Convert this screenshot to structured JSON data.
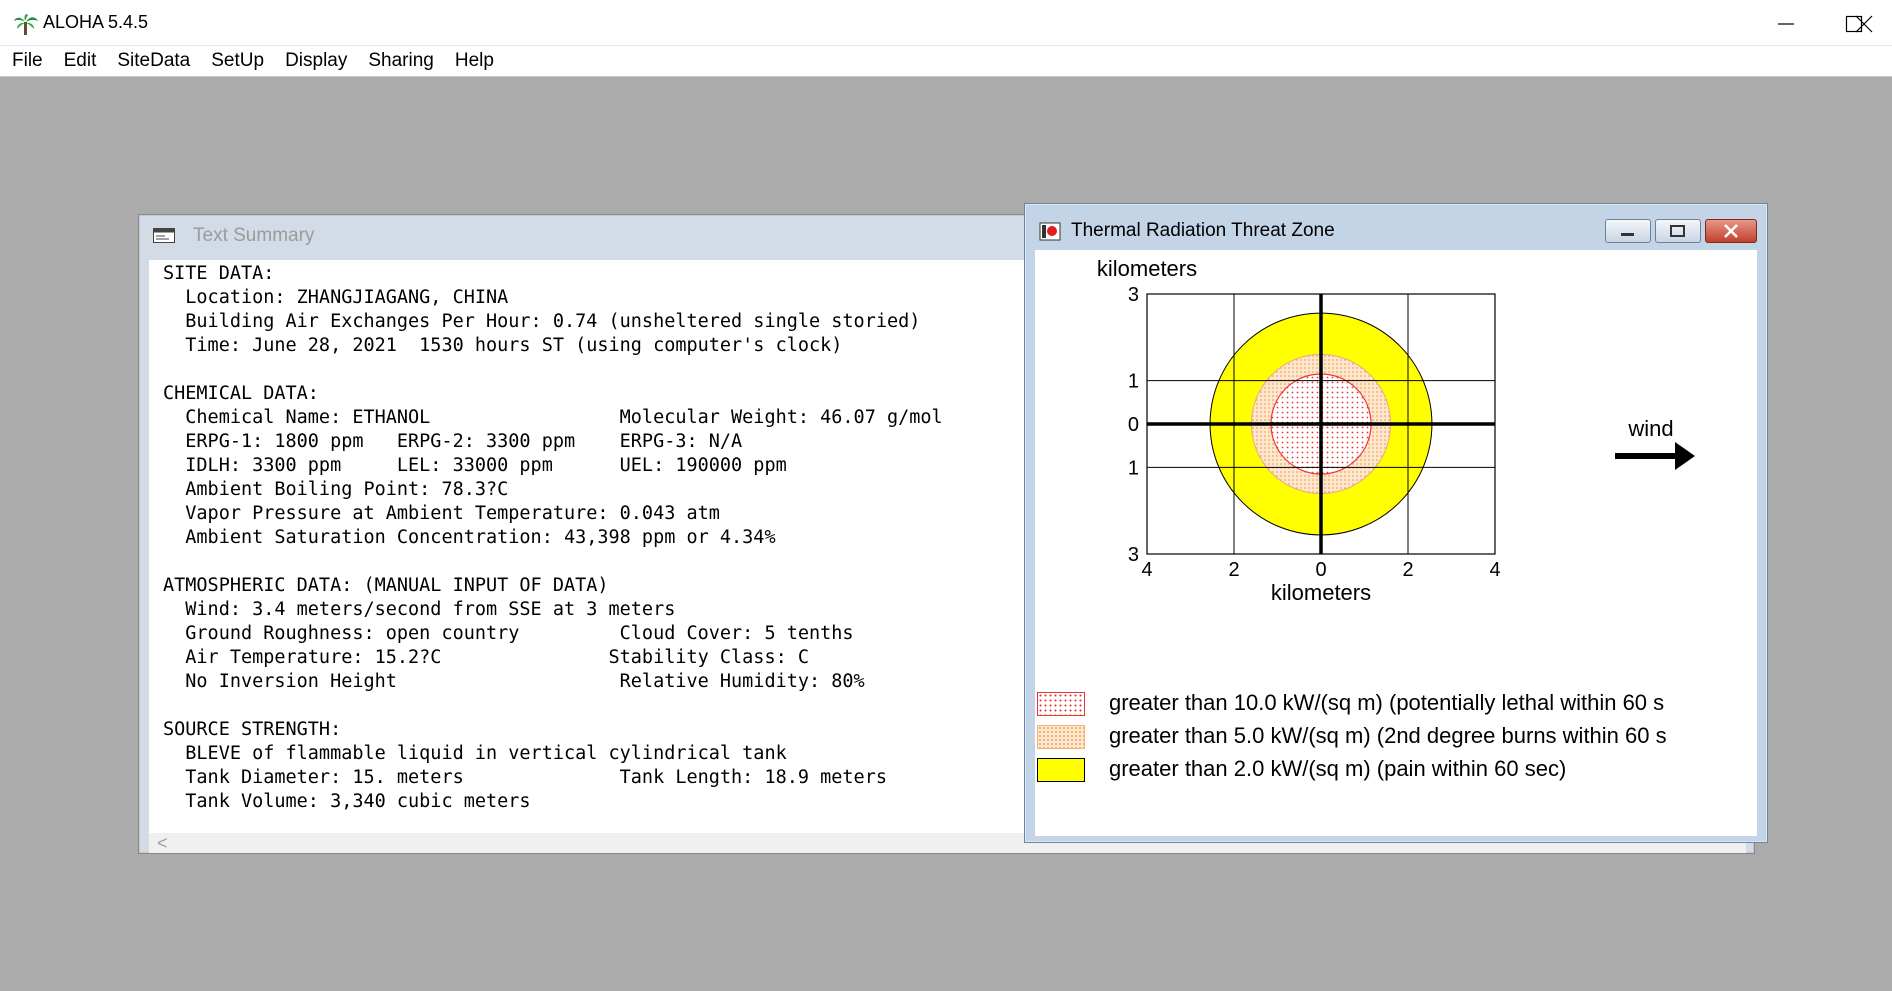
{
  "app": {
    "title": "ALOHA 5.4.5",
    "icon": "palm-tree-icon",
    "controls": [
      "minimize-icon",
      "maximize-icon",
      "close-icon"
    ]
  },
  "menu": [
    "File",
    "Edit",
    "SiteData",
    "SetUp",
    "Display",
    "Sharing",
    "Help"
  ],
  "summary": {
    "title": "Text Summary",
    "lines": [
      "SITE DATA:",
      "  Location: ZHANGJIAGANG, CHINA",
      "  Building Air Exchanges Per Hour: 0.74 (unsheltered single storied)",
      "  Time: June 28, 2021  1530 hours ST (using computer's clock)",
      "",
      "CHEMICAL DATA:",
      "  Chemical Name: ETHANOL                 Molecular Weight: 46.07 g/mol",
      "  ERPG-1: 1800 ppm   ERPG-2: 3300 ppm    ERPG-3: N/A",
      "  IDLH: 3300 ppm     LEL: 33000 ppm      UEL: 190000 ppm",
      "  Ambient Boiling Point: 78.3?C",
      "  Vapor Pressure at Ambient Temperature: 0.043 atm",
      "  Ambient Saturation Concentration: 43,398 ppm or 4.34%",
      "",
      "ATMOSPHERIC DATA: (MANUAL INPUT OF DATA)",
      "  Wind: 3.4 meters/second from SSE at 3 meters",
      "  Ground Roughness: open country         Cloud Cover: 5 tenths",
      "  Air Temperature: 15.2?C               Stability Class: C",
      "  No Inversion Height                    Relative Humidity: 80%",
      "",
      "SOURCE STRENGTH:",
      "  BLEVE of flammable liquid in vertical cylindrical tank",
      "  Tank Diameter: 15. meters              Tank Length: 18.9 meters",
      "  Tank Volume: 3,340 cubic meters"
    ],
    "scroll_left_glyph": "<"
  },
  "threat": {
    "title": "Thermal Radiation Threat Zone",
    "wind_label": "wind",
    "legend": [
      {
        "text": "greater than 10.0 kW/(sq m) (potentially lethal within 60 s",
        "color": "#ff0000",
        "pattern": "red-dots"
      },
      {
        "text": "greater than 5.0 kW/(sq m) (2nd degree burns within 60 s",
        "color": "#f5a060",
        "pattern": "orange-dots"
      },
      {
        "text": "greater than 2.0 kW/(sq m) (pain within 60 sec)",
        "color": "#ffff00",
        "pattern": "solid-yellow"
      }
    ]
  },
  "chart_data": {
    "type": "threat-zone",
    "xlabel": "kilometers",
    "ylabel": "kilometers",
    "x_ticks": [
      "4",
      "2",
      "0",
      "2",
      "4"
    ],
    "x_tick_values": [
      -4,
      -2,
      0,
      2,
      4
    ],
    "y_ticks": [
      "3",
      "1",
      "0",
      "1",
      "3"
    ],
    "y_tick_values": [
      3,
      1,
      0,
      -1,
      -3
    ],
    "xlim": [
      -4,
      4
    ],
    "ylim": [
      -3,
      3
    ],
    "zones": [
      {
        "name": "greater than 2.0 kW/(sq m)",
        "radius_km": 2.55,
        "fill": "#ffff00"
      },
      {
        "name": "greater than 5.0 kW/(sq m)",
        "radius_km": 1.6,
        "fill": "#fbe3c2"
      },
      {
        "name": "greater than 10.0 kW/(sq m)",
        "radius_km": 1.15,
        "fill": "#ffeaea"
      }
    ],
    "grid": true
  }
}
